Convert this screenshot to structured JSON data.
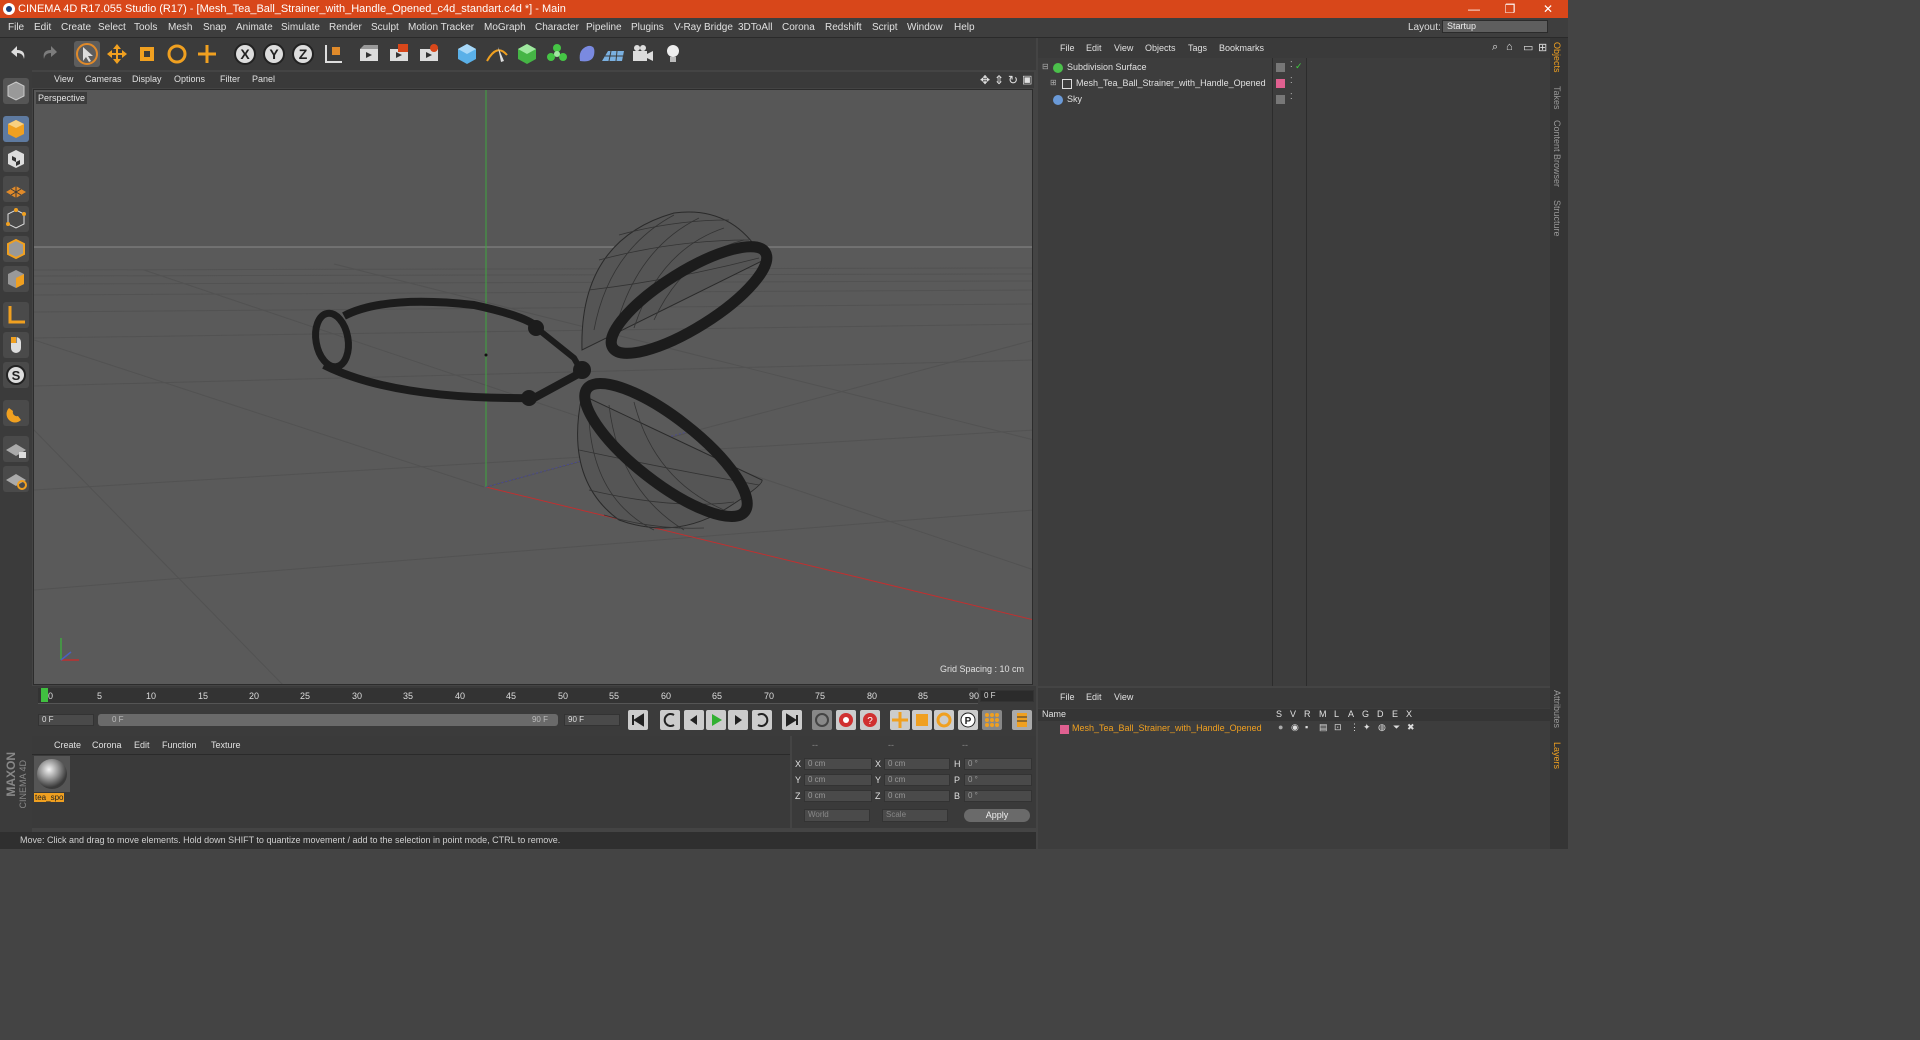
{
  "window": {
    "title": "CINEMA 4D R17.055 Studio (R17) - [Mesh_Tea_Ball_Strainer_with_Handle_Opened_c4d_standart.c4d *] - Main",
    "minimize": "—",
    "restore": "❐",
    "close": "✕"
  },
  "menu": [
    "File",
    "Edit",
    "Create",
    "Select",
    "Tools",
    "Mesh",
    "Snap",
    "Animate",
    "Simulate",
    "Render",
    "Sculpt",
    "Motion Tracker",
    "MoGraph",
    "Character",
    "Pipeline",
    "Plugins",
    "V-Ray Bridge",
    "3DToAll",
    "Corona",
    "Redshift",
    "Script",
    "Window",
    "Help"
  ],
  "layout": {
    "label": "Layout:",
    "value": "Startup"
  },
  "viewport": {
    "menu": [
      "View",
      "Cameras",
      "Display",
      "Options",
      "Filter",
      "Panel"
    ],
    "label": "Perspective",
    "grid_spacing": "Grid Spacing : 10 cm"
  },
  "timeline": {
    "ticks": [
      "0",
      "5",
      "10",
      "15",
      "20",
      "25",
      "30",
      "35",
      "40",
      "45",
      "50",
      "55",
      "60",
      "65",
      "70",
      "75",
      "80",
      "85",
      "90"
    ],
    "current_frame": "0 F",
    "start_field": "0 F",
    "range_start": "0 F",
    "range_end": "90 F",
    "end_field": "90 F"
  },
  "materials": {
    "menu": [
      "Create",
      "Corona",
      "Edit",
      "Function",
      "Texture"
    ],
    "items": [
      {
        "name": "tea_spo"
      }
    ]
  },
  "coords": {
    "headers": [
      "--",
      "--",
      "--"
    ],
    "rows": [
      {
        "axis": "X",
        "pos": "0 cm",
        "axis2": "X",
        "size": "0 cm",
        "rot_axis": "H",
        "rot": "0 °"
      },
      {
        "axis": "Y",
        "pos": "0 cm",
        "axis2": "Y",
        "size": "0 cm",
        "rot_axis": "P",
        "rot": "0 °"
      },
      {
        "axis": "Z",
        "pos": "0 cm",
        "axis2": "Z",
        "size": "0 cm",
        "rot_axis": "B",
        "rot": "0 °"
      }
    ],
    "mode": "World",
    "scale": "Scale",
    "apply": "Apply"
  },
  "status": "Move: Click and drag to move elements. Hold down SHIFT to quantize movement / add to the selection in point mode, CTRL to remove.",
  "objects": {
    "menu": [
      "File",
      "Edit",
      "View",
      "Objects",
      "Tags",
      "Bookmarks"
    ],
    "items": [
      {
        "name": "Subdivision Surface",
        "color": "#4bc04b"
      },
      {
        "name": "Mesh_Tea_Ball_Strainer_with_Handle_Opened",
        "color": "#e06090"
      },
      {
        "name": "Sky",
        "color": "#6a9ad8"
      }
    ]
  },
  "layers": {
    "menu": [
      "File",
      "Edit",
      "View"
    ],
    "columns": [
      "Name",
      "S",
      "V",
      "R",
      "M",
      "L",
      "A",
      "G",
      "D",
      "E",
      "X"
    ],
    "items": [
      {
        "name": "Mesh_Tea_Ball_Strainer_with_Handle_Opened",
        "color": "#e06090"
      }
    ]
  },
  "side_tabs": [
    "Objects",
    "Takes",
    "Content Browser",
    "Structure",
    "Attributes",
    "Layers"
  ],
  "brand": {
    "maxon": "MAXON",
    "c4d": "CINEMA 4D"
  },
  "colors": {
    "accent": "#d8471a",
    "selected": "#f0a020",
    "timeline_marker": "#40c040"
  }
}
